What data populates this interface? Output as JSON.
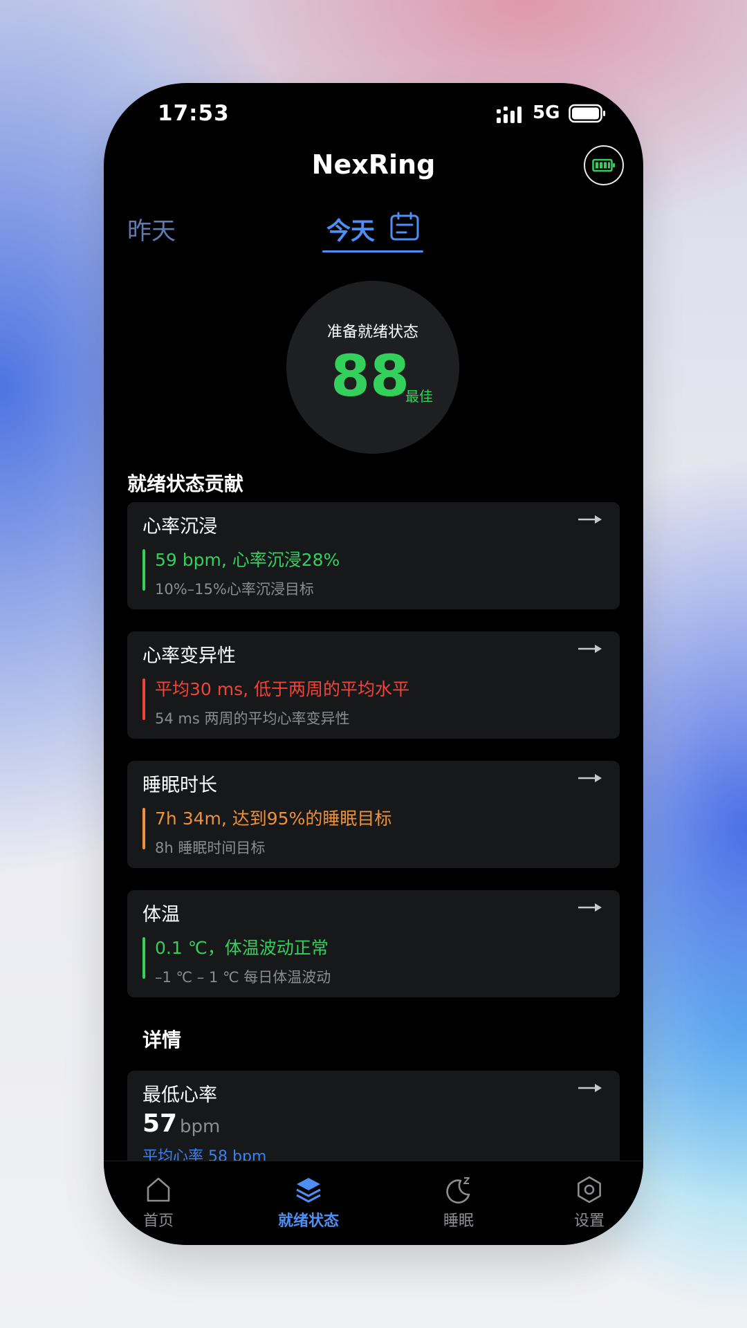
{
  "status_bar": {
    "time": "17:53",
    "network": "5G"
  },
  "header": {
    "title": "NexRing",
    "battery_icon": "battery-icon"
  },
  "day_tabs": {
    "yesterday": "昨天",
    "today": "今天",
    "calendar_icon": "calendar-icon"
  },
  "score": {
    "label": "准备就绪状态",
    "value": "88",
    "grade": "最佳"
  },
  "contributors": {
    "title": "就绪状态贡献",
    "items": [
      {
        "title": "心率沉浸",
        "line1": "59 bpm, 心率沉浸28%",
        "line2": "10%–15%心率沉浸目标",
        "color": "#33d15c"
      },
      {
        "title": "心率变异性",
        "line1": "平均30 ms, 低于两周的平均水平",
        "line2": "54 ms 两周的平均心率变异性",
        "color": "#f0443a"
      },
      {
        "title": "睡眠时长",
        "line1": "7h 34m, 达到95%的睡眠目标",
        "line2": "8h 睡眠时间目标",
        "color": "#f0913a"
      },
      {
        "title": "体温",
        "line1": "0.1 ℃，体温波动正常",
        "line2": "–1 ℃ – 1 ℃ 每日体温波动",
        "color": "#33d15c"
      }
    ]
  },
  "details": {
    "title": "详情",
    "card": {
      "title": "最低心率",
      "value": "57",
      "unit": "bpm",
      "sub": "平均心率 58 bpm"
    }
  },
  "bottom_nav": [
    {
      "label": "首页",
      "icon": "home-icon",
      "active": false
    },
    {
      "label": "就绪状态",
      "icon": "layers-icon",
      "active": true
    },
    {
      "label": "睡眠",
      "icon": "moon-icon",
      "active": false
    },
    {
      "label": "设置",
      "icon": "gear-icon",
      "active": false
    }
  ],
  "colors": {
    "accent": "#4d8ff5",
    "good": "#33d15c",
    "bad": "#f0443a",
    "warn": "#f0913a"
  }
}
